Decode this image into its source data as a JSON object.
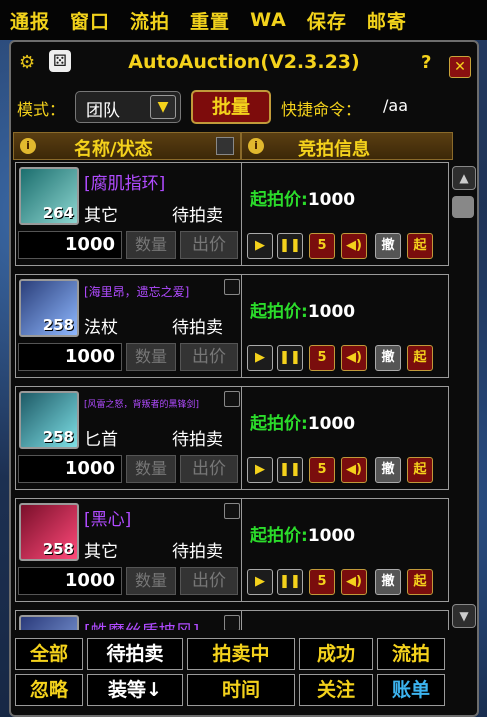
{
  "topbar": [
    "通报",
    "窗口",
    "流拍",
    "重置",
    "WA",
    "保存",
    "邮寄"
  ],
  "title": "AutoAuction(V2.3.23)",
  "mode": {
    "label": "模式：",
    "value": "团队",
    "batch_label": "批量",
    "command_label": "快捷命令：",
    "command_value": "/aa"
  },
  "columns": {
    "name": "名称/状态",
    "info": "竞拍信息"
  },
  "items": [
    {
      "name": "[腐肌指环]",
      "level": "264",
      "type": "其它",
      "status": "待拍卖",
      "price": "1000",
      "qty_placeholder": "数量",
      "sell_label": "出价",
      "start_key": "起拍价:",
      "start_value": "1000",
      "icon_colors": [
        "#1c6e6e",
        "#8dd6d0"
      ]
    },
    {
      "name": "[海里昂，遗忘之爱]",
      "level": "258",
      "type": "法杖",
      "status": "待拍卖",
      "price": "1000",
      "qty_placeholder": "数量",
      "sell_label": "出价",
      "start_key": "起拍价:",
      "start_value": "1000",
      "icon_colors": [
        "#2b3f7a",
        "#8fb8ff"
      ]
    },
    {
      "name": "[风雷之怒，背叛者的黑锋剑]",
      "level": "258",
      "type": "匕首",
      "status": "待拍卖",
      "price": "1000",
      "qty_placeholder": "数量",
      "sell_label": "出价",
      "start_key": "起拍价:",
      "start_value": "1000",
      "icon_colors": [
        "#1e5a66",
        "#7ee0e6"
      ]
    },
    {
      "name": "[黑心]",
      "level": "258",
      "type": "其它",
      "status": "待拍卖",
      "price": "1000",
      "qty_placeholder": "数量",
      "sell_label": "出价",
      "start_key": "起拍价:",
      "start_value": "1000",
      "icon_colors": [
        "#7a0f2a",
        "#ff4a7a"
      ]
    },
    {
      "name": "[蛛魔丝质披风]",
      "level": "",
      "type": "",
      "status": "",
      "price": "",
      "qty_placeholder": "",
      "sell_label": "",
      "start_key": "",
      "start_value": "",
      "icon_colors": [
        "#2a3a7a",
        "#8aa8e6"
      ]
    }
  ],
  "controls": [
    "▶",
    "❚❚",
    "5",
    "◀)",
    "撤",
    "起"
  ],
  "tabs": [
    {
      "label": "全部",
      "color": "yellow"
    },
    {
      "label": "待拍卖",
      "color": "white"
    },
    {
      "label": "拍卖中",
      "color": "yellow"
    },
    {
      "label": "成功",
      "color": "yellow"
    },
    {
      "label": "流拍",
      "color": "yellow"
    },
    {
      "label": "忽略",
      "color": "yellow"
    },
    {
      "label": "装等↓",
      "color": "white"
    },
    {
      "label": "时间",
      "color": "yellow"
    },
    {
      "label": "关注",
      "color": "yellow"
    },
    {
      "label": "账单",
      "color": "blue"
    }
  ]
}
